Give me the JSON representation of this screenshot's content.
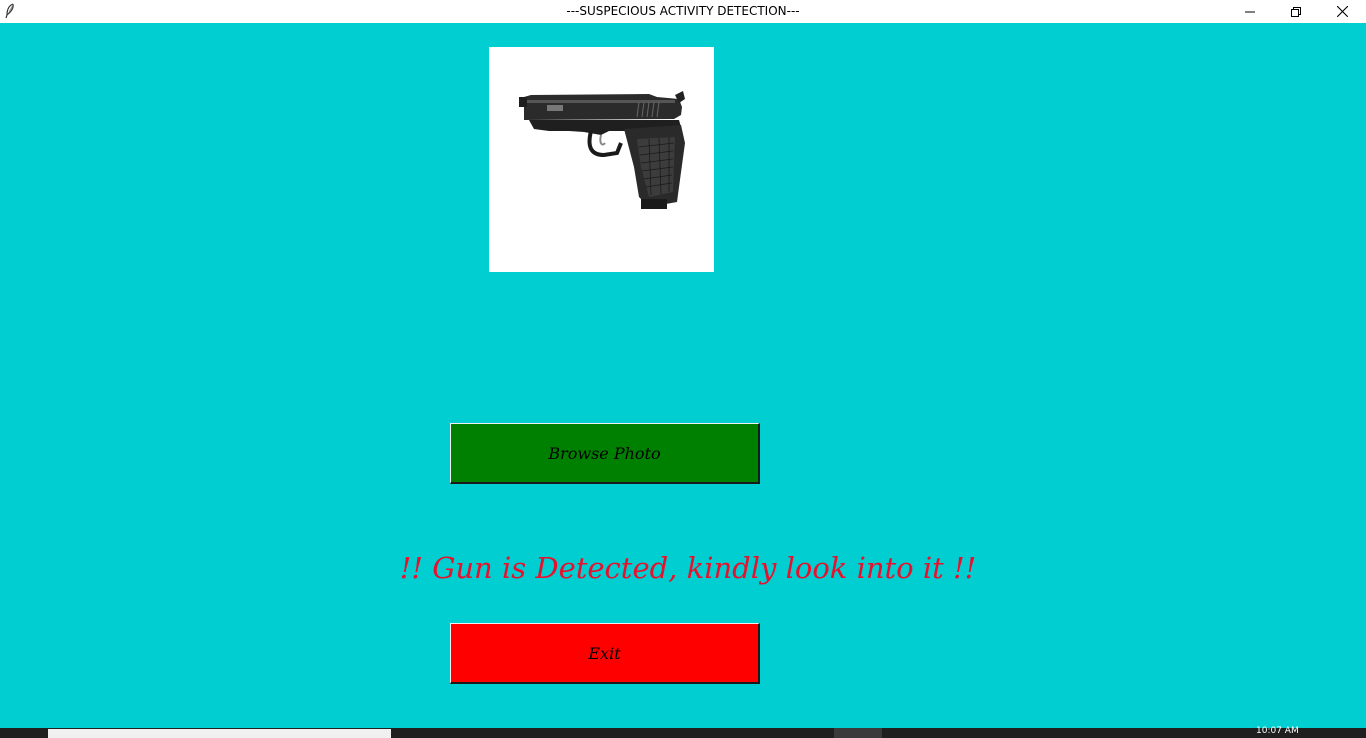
{
  "window": {
    "title": "---SUSPECIOUS ACTIVITY DETECTION---",
    "background": "#00CED1",
    "app_icon": "feather-icon",
    "controls": {
      "minimize_icon": "minimize-icon",
      "restore_icon": "restore-icon",
      "close_icon": "close-icon"
    }
  },
  "main": {
    "preview_image": {
      "icon": "pistol-image",
      "background": "#FFFFFF"
    },
    "browse_button": {
      "label": "Browse Photo",
      "color": "#008000"
    },
    "detection_message": {
      "text": "!! Gun is Detected, kindly look into it !!",
      "color": "#E8112D"
    },
    "exit_button": {
      "label": "Exit",
      "color": "#FF0000"
    }
  },
  "taskbar": {
    "clock": "10:07 AM"
  }
}
